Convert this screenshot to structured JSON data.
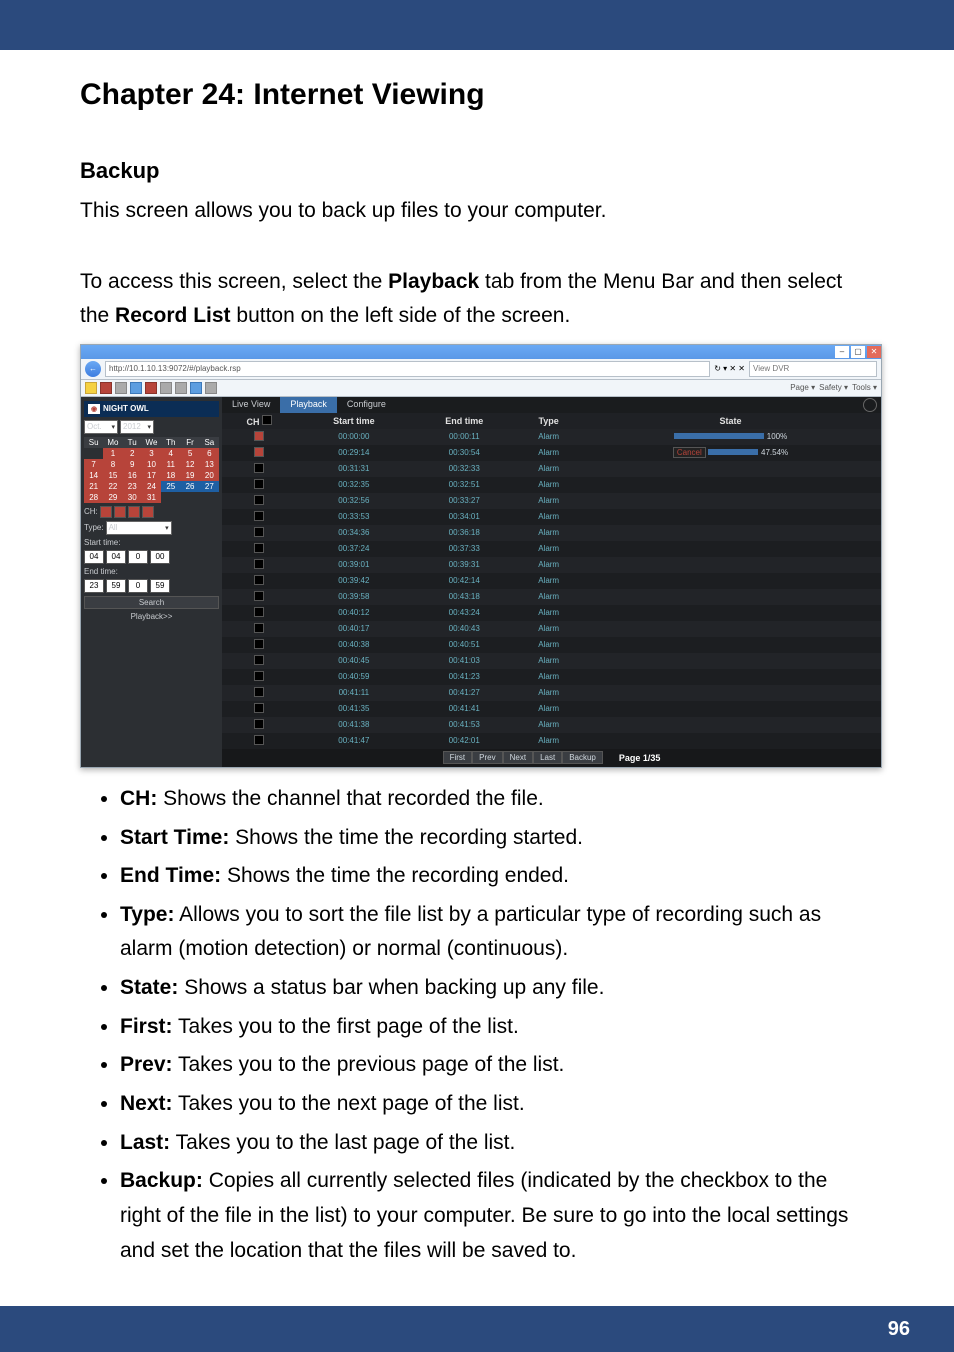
{
  "chapter_title": "Chapter 24: Internet Viewing",
  "section_title": "Backup",
  "intro_text": "This screen allows you to back up files to your computer.",
  "access_text_1": "To access this screen, select the ",
  "access_text_bold_1": "Playback",
  "access_text_2": " tab from the Menu Bar and then select the ",
  "access_text_bold_2": "Record List",
  "access_text_3": " button on the left side of the screen.",
  "page_number": "96",
  "browser": {
    "url": "http://10.1.10.13:9072/#/playback.rsp",
    "search_placeholder": "View DVR",
    "reload_group": "↻ ▾ ✕ ✕",
    "menu_items": [
      "Page",
      "Safety",
      "Tools"
    ],
    "brand": "NIGHT OWL"
  },
  "sidebar": {
    "month": "Oct.",
    "year": "2012",
    "dow": [
      "Su",
      "Mo",
      "Tu",
      "We",
      "Th",
      "Fr",
      "Sa"
    ],
    "weeks": [
      [
        "",
        "1",
        "2",
        "3",
        "4",
        "5",
        "6"
      ],
      [
        "7",
        "8",
        "9",
        "10",
        "11",
        "12",
        "13"
      ],
      [
        "14",
        "15",
        "16",
        "17",
        "18",
        "19",
        "20"
      ],
      [
        "21",
        "22",
        "23",
        "24",
        "25",
        "26",
        "27"
      ],
      [
        "28",
        "29",
        "30",
        "31",
        "",
        "",
        ""
      ]
    ],
    "selected_days": [
      "25",
      "26",
      "27"
    ],
    "ch_label": "CH:",
    "type_label": "Type:",
    "type_value": "All",
    "start_label": "Start time:",
    "start_time": [
      "04",
      "04",
      "0",
      "00"
    ],
    "end_label": "End time:",
    "end_time": [
      "23",
      "59",
      "0",
      "59"
    ],
    "search_btn": "Search",
    "playback_btn": "Playback>>"
  },
  "tabs": {
    "live": "Live View",
    "playback": "Playback",
    "configure": "Configure"
  },
  "table": {
    "headers": [
      "CH",
      "Start time",
      "End time",
      "Type",
      "State"
    ],
    "state_done": "100%",
    "state_partial": "47.54%",
    "cancel": "Cancel",
    "rows": [
      {
        "ck": true,
        "st": "00:00:00",
        "et": "00:00:11",
        "ty": "Alarm"
      },
      {
        "ck": true,
        "st": "00:29:14",
        "et": "00:30:54",
        "ty": "Alarm"
      },
      {
        "ck": false,
        "st": "00:31:31",
        "et": "00:32:33",
        "ty": "Alarm"
      },
      {
        "ck": false,
        "st": "00:32:35",
        "et": "00:32:51",
        "ty": "Alarm"
      },
      {
        "ck": false,
        "st": "00:32:56",
        "et": "00:33:27",
        "ty": "Alarm"
      },
      {
        "ck": false,
        "st": "00:33:53",
        "et": "00:34:01",
        "ty": "Alarm"
      },
      {
        "ck": false,
        "st": "00:34:36",
        "et": "00:36:18",
        "ty": "Alarm"
      },
      {
        "ck": false,
        "st": "00:37:24",
        "et": "00:37:33",
        "ty": "Alarm"
      },
      {
        "ck": false,
        "st": "00:39:01",
        "et": "00:39:31",
        "ty": "Alarm"
      },
      {
        "ck": false,
        "st": "00:39:42",
        "et": "00:42:14",
        "ty": "Alarm"
      },
      {
        "ck": false,
        "st": "00:39:58",
        "et": "00:43:18",
        "ty": "Alarm"
      },
      {
        "ck": false,
        "st": "00:40:12",
        "et": "00:43:24",
        "ty": "Alarm"
      },
      {
        "ck": false,
        "st": "00:40:17",
        "et": "00:40:43",
        "ty": "Alarm"
      },
      {
        "ck": false,
        "st": "00:40:38",
        "et": "00:40:51",
        "ty": "Alarm"
      },
      {
        "ck": false,
        "st": "00:40:45",
        "et": "00:41:03",
        "ty": "Alarm"
      },
      {
        "ck": false,
        "st": "00:40:59",
        "et": "00:41:23",
        "ty": "Alarm"
      },
      {
        "ck": false,
        "st": "00:41:11",
        "et": "00:41:27",
        "ty": "Alarm"
      },
      {
        "ck": false,
        "st": "00:41:35",
        "et": "00:41:41",
        "ty": "Alarm"
      },
      {
        "ck": false,
        "st": "00:41:38",
        "et": "00:41:53",
        "ty": "Alarm"
      },
      {
        "ck": false,
        "st": "00:41:47",
        "et": "00:42:01",
        "ty": "Alarm"
      }
    ]
  },
  "pager": {
    "btns": [
      "First",
      "Prev",
      "Next",
      "Last",
      "Backup"
    ],
    "info": "Page 1/35"
  },
  "bullets": [
    {
      "b": "CH:",
      "t": " Shows the channel that recorded the file."
    },
    {
      "b": "Start Time:",
      "t": " Shows the time the recording started."
    },
    {
      "b": "End Time:",
      "t": " Shows the time the recording ended."
    },
    {
      "b": "Type:",
      "t": " Allows you to sort the file list by a particular type of recording such as alarm (motion detection) or normal (continuous)."
    },
    {
      "b": "State:",
      "t": " Shows a status bar when backing up any file."
    },
    {
      "b": "First:",
      "t": " Takes you to the first page of the list."
    },
    {
      "b": "Prev:",
      "t": " Takes you to the previous page of the list."
    },
    {
      "b": "Next:",
      "t": " Takes you to the next page of the list."
    },
    {
      "b": "Last:",
      "t": " Takes you to the last page of the list."
    },
    {
      "b": "Backup:",
      "t": " Copies all currently selected files (indicated by the checkbox to the right of the file in the list) to your computer. Be sure to go into the local settings and set the location that the files will be saved to."
    }
  ]
}
